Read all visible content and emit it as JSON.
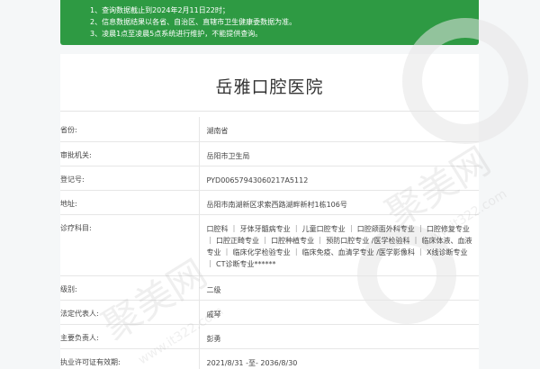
{
  "notice": {
    "lines": [
      "1、查询数据截止到2024年2月11日22时；",
      "2、信息数据结果以各省、自治区、直辖市卫生健康委数据为准。",
      "3、凌晨1点至凌晨5点系统进行维护，不能提供查询。"
    ]
  },
  "hospital": {
    "name": "岳雅口腔医院"
  },
  "rows": [
    {
      "label": "省份:",
      "value": "湖南省"
    },
    {
      "label": "审批机关:",
      "value": "岳阳市卫生局"
    },
    {
      "label": "登记号:",
      "value": "PYD00657943060217A5112"
    },
    {
      "label": "地址:",
      "value": "岳阳市南湖新区求索西路湖畔新村1栋106号"
    },
    {
      "label": "诊疗科目:",
      "value": "口腔科 ｜ 牙体牙髓病专业 ｜ 儿童口腔专业 ｜ 口腔颌面外科专业 ｜ 口腔修复专业 ｜ 口腔正畸专业 ｜ 口腔种植专业 ｜ 预防口腔专业 /医学检验科 ｜ 临床体液、血液专业 ｜ 临床化学检验专业 ｜ 临床免疫、血清学专业 /医学影像科 ｜ X线诊断专业 ｜ CT诊断专业******"
    },
    {
      "label": "级别:",
      "value": "二级"
    },
    {
      "label": "法定代表人:",
      "value": "戚琴"
    },
    {
      "label": "主要负责人:",
      "value": "彭勇"
    },
    {
      "label": "执业许可证有效期:",
      "value": "2021/8/31 -至- 2036/8/30"
    }
  ],
  "watermark": {
    "text": "聚美网",
    "url": "www.it322.com"
  }
}
